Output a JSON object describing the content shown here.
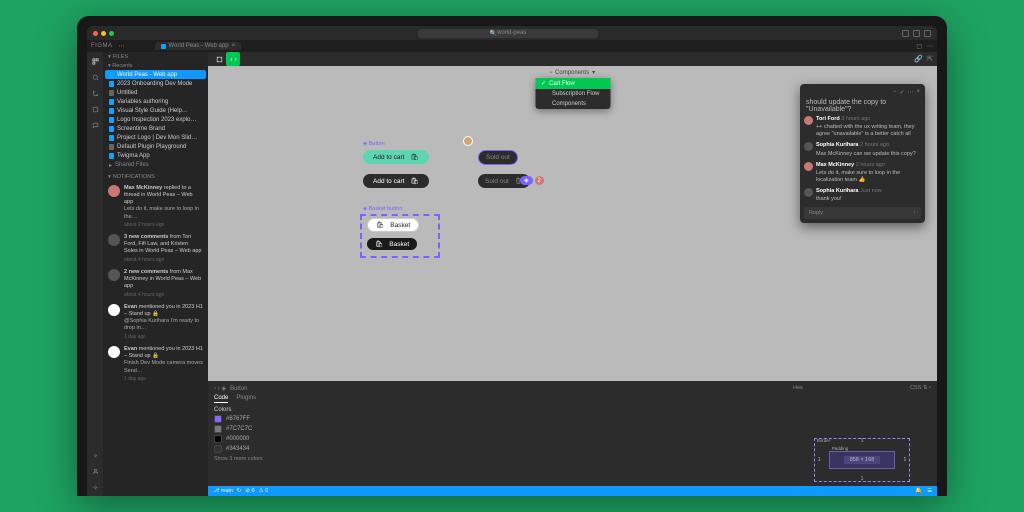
{
  "macbar": {
    "search": "world-peas"
  },
  "app_name": "FIGMA",
  "tab": "World Peas - Web app",
  "sections": {
    "files": "FILES",
    "notifications": "NOTIFICATIONS"
  },
  "files": [
    "World Peas - Web app",
    "2023 Onboarding Dev Mode",
    "Untitled",
    "Variables authoring",
    "Visual Style Guide (Help…",
    "Logo Inspection 2023 explo…",
    "Screentime Brand",
    "Project Logo | Dev Mon Slid…",
    "Default Plugin Playground",
    "Twigma App",
    "Shared Files"
  ],
  "recents": "Recents",
  "notifs": [
    {
      "author": "Max McKinney",
      "text": "replied to a thread in World Peas – Web app",
      "body": "Lets do it, make sure to loop in the…",
      "time": "about 2 hours ago"
    },
    {
      "author": "3 new comments",
      "text": "from Tori Ford, Fifi Law, and Kristen Soles in World Peas – Web app",
      "time": "about 4 hours ago"
    },
    {
      "author": "2 new comments",
      "text": "from Max McKinney in World Peas – Web app",
      "time": "about 4 hours ago"
    },
    {
      "author": "Evan",
      "text": "mentioned you in 2023 H1 – Stand up 🔒",
      "body": "@Sophia Kurihara I'm ready to drop in…",
      "time": "1 day ago"
    },
    {
      "author": "Evan",
      "text": "mentioned you in 2023 H1 – Stand up 🔒",
      "body": "Finish Dev Mode camera moves Send…",
      "time": "1 day ago"
    }
  ],
  "page": {
    "label": "Components",
    "items": [
      "Cart Flow",
      "Subscription Flow",
      "Components"
    ]
  },
  "canvas": {
    "button_label": "Button",
    "basket_label": "Basket button",
    "add_to_cart": "Add to cart",
    "sold_out": "Sold out",
    "basket": "Basket",
    "cursor_count": "2"
  },
  "comments": {
    "first": "should update the copy to \"Unavailable\"?",
    "items": [
      {
        "name": "Tori Ford",
        "time": "3 hours ago",
        "text": "++ chatted with the ux writing team, they agree \"unavailable\" is a better catch all"
      },
      {
        "name": "Sophia Kurihara",
        "time": "2 hours ago",
        "text": "Max McKinney can we update this copy?"
      },
      {
        "name": "Max McKinney",
        "time": "2 hours ago",
        "text": "Lets do it, make sure to loop in the localization team 👍"
      },
      {
        "name": "Sophia Kurihara",
        "time": "Just now",
        "text": "thank you!"
      }
    ],
    "reply": "Reply"
  },
  "inspect": {
    "crumb_layer": "Button",
    "tabs": {
      "code": "Code",
      "plugins": "Plugins"
    },
    "colors_label": "Colors",
    "hex_label": "Hex",
    "colors": [
      {
        "hex": "#8767FF"
      },
      {
        "hex": "#7C7C7C"
      },
      {
        "hex": "#000000"
      },
      {
        "hex": "#343434"
      }
    ],
    "more": "Show 3 more colors",
    "css_label": "CSS",
    "box": {
      "border": "Border",
      "padding": "Padding",
      "dim": "858 × 168",
      "val": "1"
    }
  },
  "statusbar": {
    "branch": "main"
  }
}
